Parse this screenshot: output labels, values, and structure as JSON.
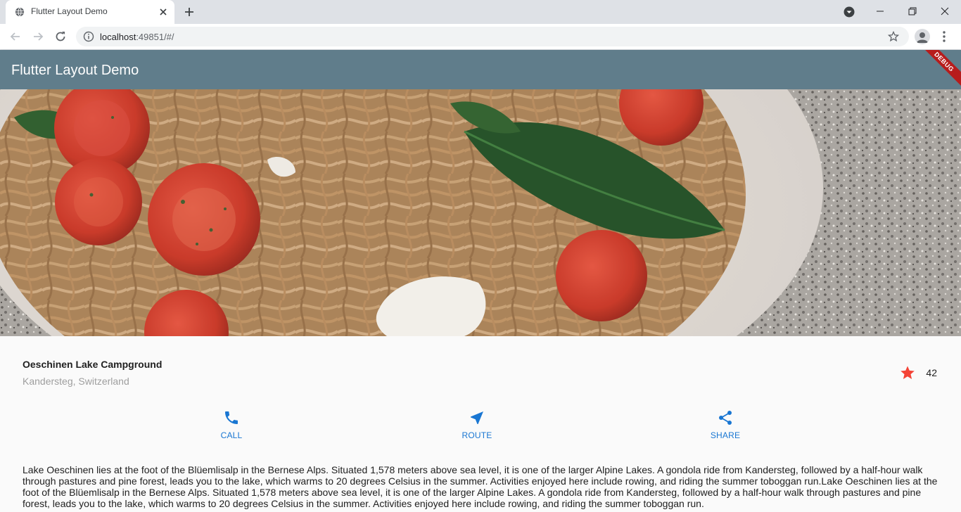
{
  "browser": {
    "tab_title": "Flutter Layout Demo",
    "url_host": "localhost",
    "url_rest": ":49851/#/",
    "icons": {
      "favicon": "globe-icon",
      "tab_close": "close-icon",
      "new_tab": "plus-icon",
      "tab_search": "chevron-down-icon",
      "back": "arrow-left-icon",
      "forward": "arrow-right-icon",
      "reload": "reload-icon",
      "site_info": "info-icon",
      "bookmark": "star-outline-icon",
      "profile": "person-icon",
      "menu": "kebab-icon"
    }
  },
  "app": {
    "title": "Flutter Layout Demo",
    "debug_banner": "DEBUG",
    "appbar_color": "#607d8b",
    "accent_color": "#1976d2",
    "star_color": "#f44336"
  },
  "place": {
    "name": "Oeschinen Lake Campground",
    "location": "Kandersteg, Switzerland",
    "favorite_count": "42"
  },
  "actions": [
    {
      "label": "CALL",
      "icon": "phone-icon"
    },
    {
      "label": "ROUTE",
      "icon": "navigation-icon"
    },
    {
      "label": "SHARE",
      "icon": "share-icon"
    }
  ],
  "description": "Lake Oeschinen lies at the foot of the Blüemlisalp in the Bernese Alps. Situated 1,578 meters above sea level, it is one of the larger Alpine Lakes. A gondola ride from Kandersteg, followed by a half-hour walk through pastures and pine forest, leads you to the lake, which warms to 20 degrees Celsius in the summer. Activities enjoyed here include rowing, and riding the summer toboggan run.Lake Oeschinen lies at the foot of the Blüemlisalp in the Bernese Alps. Situated 1,578 meters above sea level, it is one of the larger Alpine Lakes. A gondola ride from Kandersteg, followed by a half-hour walk through pastures and pine forest, leads you to the lake, which warms to 20 degrees Celsius in the summer. Activities enjoyed here include rowing, and riding the summer toboggan run."
}
